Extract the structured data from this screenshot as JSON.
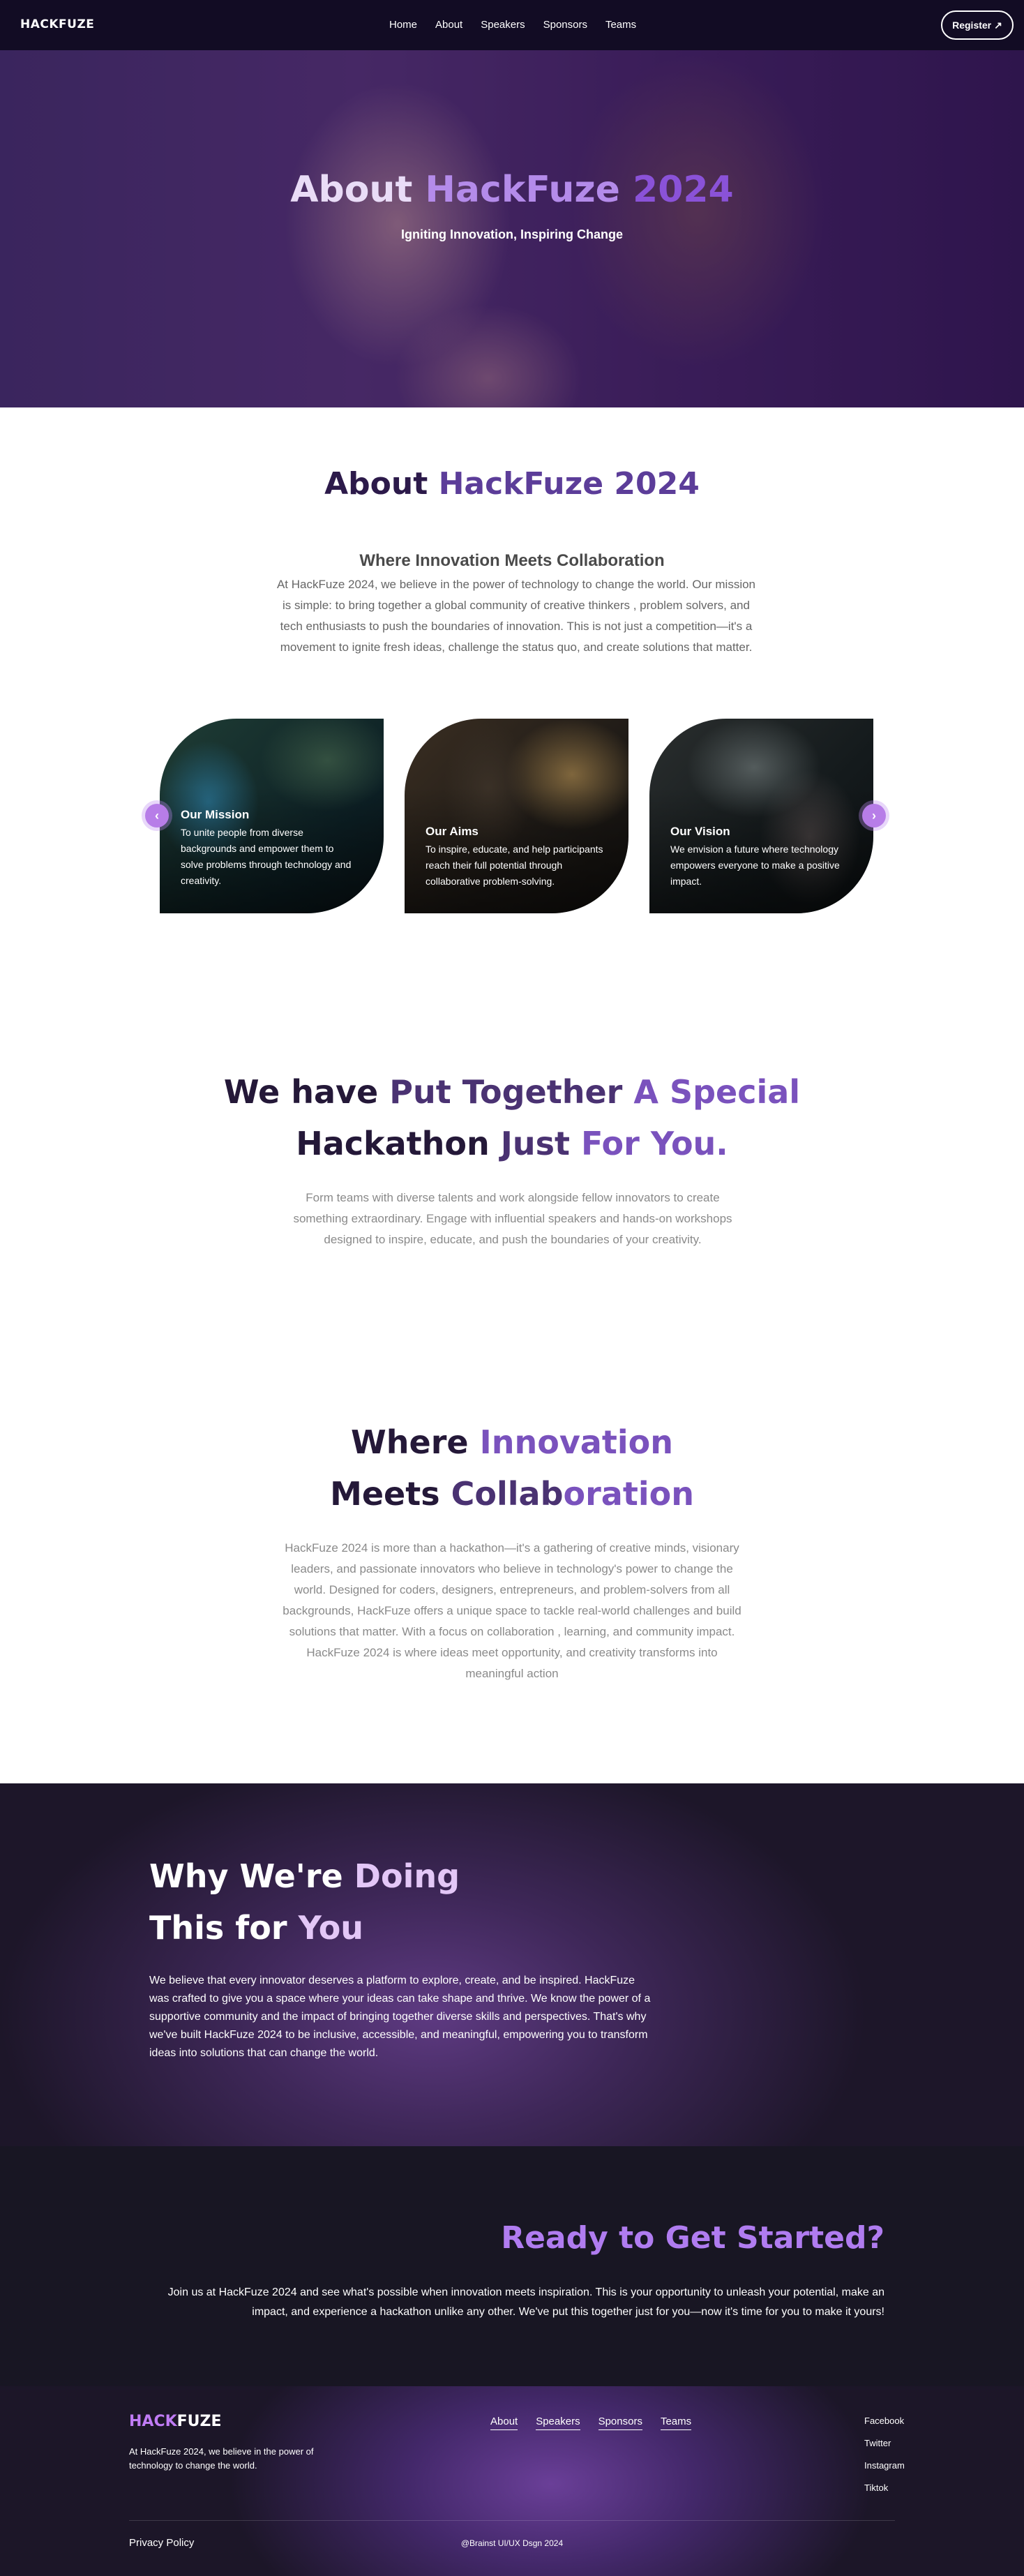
{
  "nav": {
    "logo": "HACKFUZE",
    "links": [
      "Home",
      "About",
      "Speakers",
      "Sponsors",
      "Teams"
    ],
    "register_label": "Register",
    "register_icon": "arrow-up-right-icon"
  },
  "hero": {
    "title_part1": "About ",
    "title_part2": "HackFuze ",
    "title_part3": "2024",
    "subtitle": "Igniting Innovation, Inspiring Change"
  },
  "about": {
    "title_part1": "About ",
    "title_part2": "HackFuze 2024",
    "subtitle": "Where Innovation Meets Collaboration",
    "body": "At HackFuze 2024, we believe in the power of technology to change the world. Our mission is simple: to bring together a global community of creative thinkers , problem solvers, and tech enthusiasts to push the boundaries of innovation. This is not just a competition—it's a movement to ignite fresh ideas, challenge the status quo, and create solutions that matter."
  },
  "cards": [
    {
      "title": "Our Mission",
      "text": "To unite people from diverse backgrounds and empower them to solve problems through technology and creativity."
    },
    {
      "title": "Our Aims",
      "text": "To inspire, educate, and help participants reach their full potential through collaborative problem-solving."
    },
    {
      "title": "Our Vision",
      "text": "We envision a future where technology empowers everyone to make a positive impact."
    }
  ],
  "carousel": {
    "prev_icon": "chevron-left-icon",
    "next_icon": "chevron-right-icon"
  },
  "special": {
    "t1": "We have ",
    "t2": "Put ",
    "t3": "Together ",
    "t4": "A Special",
    "t5": "Hackathon ",
    "t6": "Just ",
    "t7": "For You.",
    "body": "Form teams with diverse talents and work alongside fellow innovators to create something extraordinary. Engage with influential speakers and hands-on workshops designed to inspire, educate, and push the boundaries of your creativity."
  },
  "where": {
    "t1": "Where ",
    "t2": "Innovation",
    "t3": "Meets ",
    "t4": "Collab",
    "t5": "oration",
    "body": "HackFuze 2024 is more than a hackathon—it's a gathering of creative minds, visionary leaders, and passionate innovators who believe in technology's power to change the world. Designed for coders, designers, entrepreneurs, and problem-solvers from all backgrounds, HackFuze offers a unique space to tackle real-world challenges and build solutions that matter. With a focus on collaboration , learning, and community impact. HackFuze 2024 is where ideas meet opportunity, and creativity transforms into meaningful action"
  },
  "why": {
    "t1": "Why We're ",
    "t2": "Doing",
    "t3": "This for ",
    "t4": "You",
    "body": "We believe that every innovator deserves a platform to explore, create, and be inspired. HackFuze was crafted to give you a space where your ideas can take shape and thrive. We know the power of a supportive community and the impact of bringing together diverse skills and perspectives. That's why we've built HackFuze 2024 to be inclusive, accessible, and meaningful, empowering you to transform ideas into solutions that can change the world."
  },
  "ready": {
    "title": "Ready to Get Started?",
    "body": "Join us at HackFuze 2024 and see what's possible when innovation meets inspiration. This is your opportunity to unleash your potential, make an impact, and experience a hackathon unlike any other. We've put this together just for you—now it's time for you to make it yours!"
  },
  "footer": {
    "logo_part1": "HACK",
    "logo_part2": "FUZE",
    "about": "At HackFuze 2024, we believe in the power of technology to change the world.",
    "links": [
      "About",
      "Speakers",
      "Sponsors",
      "Teams"
    ],
    "socials": [
      "Facebook",
      "Twitter",
      "Instagram",
      "Tiktok"
    ],
    "privacy": "Privacy Policy",
    "copyright": "@Brainst UI/UX Dsgn 2024"
  },
  "colors": {
    "nav_bg": "#120c24",
    "brand_purple": "#7a52bd",
    "accent_violet": "#b07cf0",
    "dark_bg": "#181623"
  }
}
